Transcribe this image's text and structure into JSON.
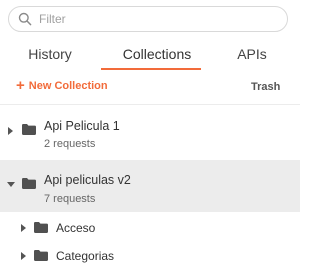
{
  "search": {
    "placeholder": "Filter",
    "icon": "search-icon"
  },
  "tabs": [
    {
      "label": "History",
      "active": false
    },
    {
      "label": "Collections",
      "active": true
    },
    {
      "label": "APIs",
      "active": false
    }
  ],
  "colors": {
    "accent": "#f26b3a",
    "selected_row": "#ececec"
  },
  "toolbar": {
    "new_collection_label": "New Collection",
    "trash_label": "Trash"
  },
  "collections": [
    {
      "name": "Api Pelicula 1",
      "subtitle": "2 requests",
      "expanded": false
    },
    {
      "name": "Api peliculas v2",
      "subtitle": "7 requests",
      "expanded": true,
      "folders": [
        {
          "name": "Acceso"
        },
        {
          "name": "Categorias"
        }
      ]
    }
  ]
}
